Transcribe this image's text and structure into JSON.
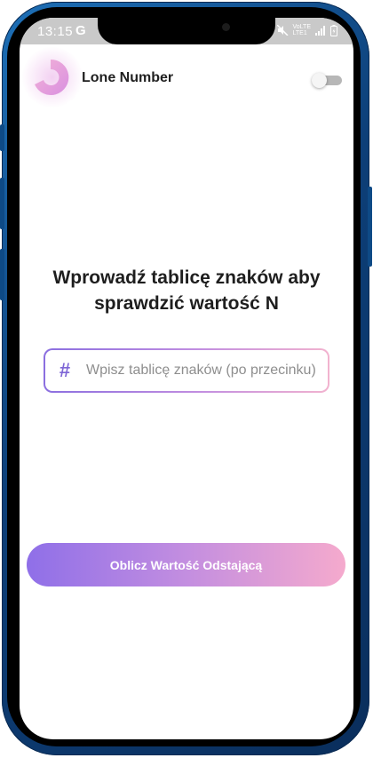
{
  "status_bar": {
    "time": "13:15",
    "g_label": "G",
    "volte_label": "VoLTE",
    "lte_label": "LTE1"
  },
  "app": {
    "title": "Lone Number",
    "theme_toggle_on": false
  },
  "main": {
    "heading_line1": "Wprowadź tablicę znaków aby",
    "heading_line2": "sprawdzić wartość N",
    "input_icon": "#",
    "input_placeholder": "Wpisz tablicę znaków (po przecinku)",
    "input_value": "",
    "button_label": "Oblicz Wartość Odstającą"
  },
  "colors": {
    "frame": "#0d3f78",
    "accent_start": "#8f6fe8",
    "accent_end": "#f5aacd",
    "hash": "#7e66d6"
  },
  "icons": [
    "logo-icon",
    "hash-icon",
    "mute-icon",
    "signal-icon",
    "battery-icon"
  ]
}
